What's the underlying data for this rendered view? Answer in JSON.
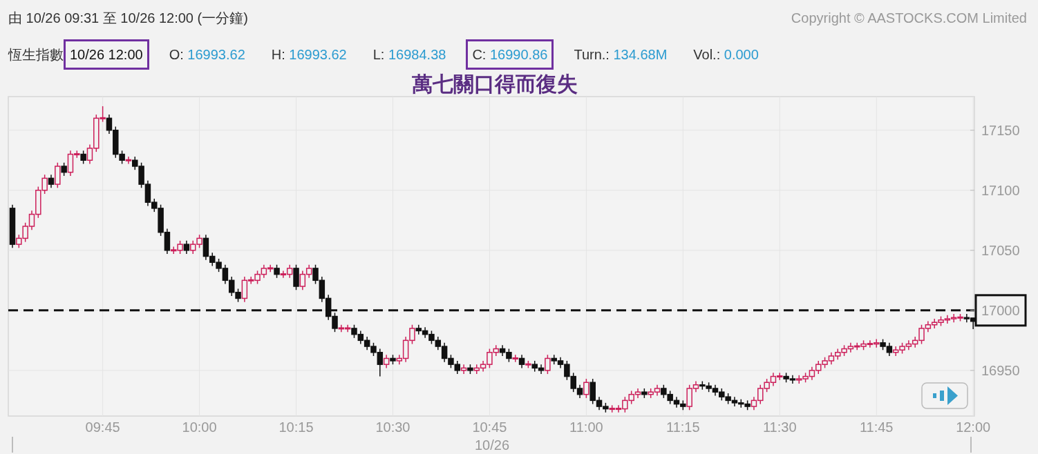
{
  "header": {
    "range": "由 10/26 09:31 至 10/26 12:00 (一分鐘)",
    "copyright": "Copyright © AASTOCKS.COM Limited"
  },
  "quote": {
    "index_name": "恆生指數",
    "time": {
      "text": "10/26 12:00",
      "highlighted": true
    },
    "fields": [
      {
        "label": "O:",
        "value": "16993.62",
        "highlighted": false
      },
      {
        "label": "H:",
        "value": "16993.62",
        "highlighted": false
      },
      {
        "label": "L:",
        "value": "16984.38",
        "highlighted": false
      },
      {
        "label": "C:",
        "value": "16990.86",
        "highlighted": true
      },
      {
        "label": "Turn.:",
        "value": "134.68M",
        "highlighted": false
      },
      {
        "label": "Vol.:",
        "value": "0.000",
        "highlighted": false
      }
    ]
  },
  "headline": "萬七關口得而復失",
  "chart": {
    "date_label": "10/26",
    "chart_data": {
      "type": "candlestick",
      "grid": true,
      "ylim": [
        16912,
        17178
      ],
      "yticks": [
        16950,
        17000,
        17050,
        17100,
        17150
      ],
      "categories": [
        null,
        null,
        null,
        null,
        null,
        null,
        null,
        null,
        null,
        null,
        null,
        null,
        null,
        null,
        "09:45",
        null,
        null,
        null,
        null,
        null,
        null,
        null,
        null,
        null,
        null,
        null,
        null,
        null,
        null,
        "10:00",
        null,
        null,
        null,
        null,
        null,
        null,
        null,
        null,
        null,
        null,
        null,
        null,
        null,
        null,
        "10:15",
        null,
        null,
        null,
        null,
        null,
        null,
        null,
        null,
        null,
        null,
        null,
        null,
        null,
        null,
        "10:30",
        null,
        null,
        null,
        null,
        null,
        null,
        null,
        null,
        null,
        null,
        null,
        null,
        null,
        null,
        "10:45",
        null,
        null,
        null,
        null,
        null,
        null,
        null,
        null,
        null,
        null,
        null,
        null,
        null,
        null,
        "11:00",
        null,
        null,
        null,
        null,
        null,
        null,
        null,
        null,
        null,
        null,
        null,
        null,
        null,
        null,
        "11:15",
        null,
        null,
        null,
        null,
        null,
        null,
        null,
        null,
        null,
        null,
        null,
        null,
        null,
        null,
        "11:30",
        null,
        null,
        null,
        null,
        null,
        null,
        null,
        null,
        null,
        null,
        null,
        null,
        null,
        null,
        "11:45",
        null,
        null,
        null,
        null,
        null,
        null,
        null,
        null,
        null,
        null,
        null,
        null,
        null,
        null,
        "12:00"
      ],
      "ohlc": [
        [
          17085,
          17088,
          17052,
          17055
        ],
        [
          17055,
          17063,
          17052,
          17060
        ],
        [
          17060,
          17073,
          17057,
          17070
        ],
        [
          17070,
          17083,
          17067,
          17080
        ],
        [
          17080,
          17103,
          17077,
          17100
        ],
        [
          17100,
          17113,
          17097,
          17110
        ],
        [
          17110,
          17113,
          17102,
          17105
        ],
        [
          17105,
          17123,
          17102,
          17120
        ],
        [
          17120,
          17123,
          17112,
          17115
        ],
        [
          17115,
          17133,
          17112,
          17130
        ],
        [
          17130,
          17133,
          17127,
          17130
        ],
        [
          17130,
          17133,
          17122,
          17125
        ],
        [
          17125,
          17138,
          17122,
          17135
        ],
        [
          17135,
          17163,
          17132,
          17160
        ],
        [
          17160,
          17170,
          17157,
          17160
        ],
        [
          17160,
          17163,
          17147,
          17150
        ],
        [
          17150,
          17153,
          17127,
          17130
        ],
        [
          17130,
          17133,
          17122,
          17125
        ],
        [
          17125,
          17128,
          17122,
          17125
        ],
        [
          17125,
          17128,
          17117,
          17120
        ],
        [
          17120,
          17123,
          17102,
          17105
        ],
        [
          17105,
          17108,
          17087,
          17090
        ],
        [
          17090,
          17093,
          17082,
          17085
        ],
        [
          17085,
          17088,
          17062,
          17065
        ],
        [
          17065,
          17068,
          17047,
          17050
        ],
        [
          17050,
          17053,
          17047,
          17050
        ],
        [
          17050,
          17058,
          17047,
          17055
        ],
        [
          17055,
          17058,
          17047,
          17050
        ],
        [
          17050,
          17058,
          17047,
          17055
        ],
        [
          17055,
          17063,
          17052,
          17060
        ],
        [
          17060,
          17063,
          17042,
          17045
        ],
        [
          17045,
          17048,
          17037,
          17040
        ],
        [
          17040,
          17043,
          17032,
          17035
        ],
        [
          17035,
          17038,
          17022,
          17025
        ],
        [
          17025,
          17028,
          17012,
          17015
        ],
        [
          17015,
          17018,
          17007,
          17010
        ],
        [
          17010,
          17028,
          17007,
          17025
        ],
        [
          17025,
          17028,
          17022,
          17025
        ],
        [
          17025,
          17033,
          17022,
          17030
        ],
        [
          17030,
          17038,
          17027,
          17035
        ],
        [
          17035,
          17038,
          17032,
          17035
        ],
        [
          17035,
          17038,
          17027,
          17030
        ],
        [
          17030,
          17033,
          17027,
          17030
        ],
        [
          17030,
          17038,
          17027,
          17035
        ],
        [
          17035,
          17038,
          17017,
          17020
        ],
        [
          17020,
          17033,
          17017,
          17030
        ],
        [
          17030,
          17038,
          17027,
          17035
        ],
        [
          17035,
          17038,
          17022,
          17025
        ],
        [
          17025,
          17028,
          17007,
          17010
        ],
        [
          17010,
          17013,
          16992,
          16995
        ],
        [
          16995,
          16998,
          16982,
          16985
        ],
        [
          16985,
          16988,
          16982,
          16985
        ],
        [
          16985,
          16988,
          16982,
          16985
        ],
        [
          16985,
          16988,
          16977,
          16980
        ],
        [
          16980,
          16983,
          16972,
          16975
        ],
        [
          16975,
          16978,
          16967,
          16970
        ],
        [
          16970,
          16973,
          16962,
          16965
        ],
        [
          16965,
          16968,
          16945,
          16955
        ],
        [
          16955,
          16963,
          16952,
          16960
        ],
        [
          16960,
          16963,
          16955,
          16958
        ],
        [
          16958,
          16963,
          16955,
          16960
        ],
        [
          16960,
          16978,
          16957,
          16975
        ],
        [
          16975,
          16988,
          16972,
          16985
        ],
        [
          16985,
          16988,
          16980,
          16983
        ],
        [
          16983,
          16986,
          16977,
          16980
        ],
        [
          16980,
          16983,
          16972,
          16975
        ],
        [
          16975,
          16978,
          16967,
          16970
        ],
        [
          16970,
          16973,
          16957,
          16960
        ],
        [
          16960,
          16963,
          16952,
          16955
        ],
        [
          16955,
          16958,
          16947,
          16950
        ],
        [
          16950,
          16955,
          16947,
          16952
        ],
        [
          16952,
          16955,
          16947,
          16950
        ],
        [
          16950,
          16955,
          16947,
          16952
        ],
        [
          16952,
          16958,
          16949,
          16955
        ],
        [
          16955,
          16968,
          16952,
          16965
        ],
        [
          16965,
          16971,
          16962,
          16968
        ],
        [
          16968,
          16971,
          16962,
          16965
        ],
        [
          16965,
          16968,
          16957,
          16960
        ],
        [
          16960,
          16963,
          16957,
          16960
        ],
        [
          16960,
          16963,
          16952,
          16955
        ],
        [
          16955,
          16958,
          16952,
          16955
        ],
        [
          16955,
          16958,
          16949,
          16952
        ],
        [
          16952,
          16955,
          16947,
          16950
        ],
        [
          16950,
          16963,
          16947,
          16960
        ],
        [
          16960,
          16963,
          16955,
          16958
        ],
        [
          16958,
          16961,
          16952,
          16955
        ],
        [
          16955,
          16958,
          16942,
          16945
        ],
        [
          16945,
          16948,
          16932,
          16935
        ],
        [
          16935,
          16938,
          16927,
          16930
        ],
        [
          16930,
          16943,
          16927,
          16940
        ],
        [
          16940,
          16943,
          16922,
          16925
        ],
        [
          16925,
          16928,
          16917,
          16920
        ],
        [
          16920,
          16923,
          16915,
          16918
        ],
        [
          16918,
          16921,
          16915,
          16918
        ],
        [
          16918,
          16921,
          16915,
          16918
        ],
        [
          16918,
          16928,
          16915,
          16925
        ],
        [
          16925,
          16933,
          16922,
          16930
        ],
        [
          16930,
          16935,
          16927,
          16932
        ],
        [
          16932,
          16935,
          16927,
          16930
        ],
        [
          16930,
          16935,
          16927,
          16932
        ],
        [
          16932,
          16938,
          16929,
          16935
        ],
        [
          16935,
          16938,
          16927,
          16930
        ],
        [
          16930,
          16933,
          16922,
          16925
        ],
        [
          16925,
          16928,
          16919,
          16922
        ],
        [
          16922,
          16925,
          16917,
          16920
        ],
        [
          16920,
          16938,
          16917,
          16935
        ],
        [
          16935,
          16941,
          16932,
          16938
        ],
        [
          16938,
          16941,
          16934,
          16937
        ],
        [
          16937,
          16940,
          16932,
          16935
        ],
        [
          16935,
          16938,
          16929,
          16932
        ],
        [
          16932,
          16935,
          16925,
          16928
        ],
        [
          16928,
          16931,
          16922,
          16925
        ],
        [
          16925,
          16928,
          16920,
          16923
        ],
        [
          16923,
          16926,
          16919,
          16922
        ],
        [
          16922,
          16925,
          16917,
          16920
        ],
        [
          16920,
          16928,
          16917,
          16925
        ],
        [
          16925,
          16938,
          16922,
          16935
        ],
        [
          16935,
          16943,
          16932,
          16940
        ],
        [
          16940,
          16948,
          16937,
          16945
        ],
        [
          16945,
          16948,
          16942,
          16945
        ],
        [
          16945,
          16948,
          16940,
          16943
        ],
        [
          16943,
          16946,
          16939,
          16942
        ],
        [
          16942,
          16946,
          16939,
          16943
        ],
        [
          16943,
          16948,
          16940,
          16945
        ],
        [
          16945,
          16953,
          16942,
          16950
        ],
        [
          16950,
          16958,
          16947,
          16955
        ],
        [
          16955,
          16961,
          16952,
          16958
        ],
        [
          16958,
          16965,
          16955,
          16962
        ],
        [
          16962,
          16968,
          16959,
          16965
        ],
        [
          16965,
          16971,
          16962,
          16968
        ],
        [
          16968,
          16973,
          16965,
          16970
        ],
        [
          16970,
          16973,
          16967,
          16970
        ],
        [
          16970,
          16975,
          16967,
          16972
        ],
        [
          16972,
          16975,
          16969,
          16972
        ],
        [
          16972,
          16976,
          16969,
          16973
        ],
        [
          16973,
          16976,
          16967,
          16970
        ],
        [
          16970,
          16973,
          16962,
          16965
        ],
        [
          16965,
          16970,
          16962,
          16967
        ],
        [
          16967,
          16973,
          16964,
          16970
        ],
        [
          16970,
          16975,
          16967,
          16972
        ],
        [
          16972,
          16978,
          16969,
          16975
        ],
        [
          16975,
          16988,
          16972,
          16985
        ],
        [
          16985,
          16991,
          16982,
          16988
        ],
        [
          16988,
          16993,
          16985,
          16990
        ],
        [
          16990,
          16995,
          16987,
          16992
        ],
        [
          16992,
          16996,
          16989,
          16993
        ],
        [
          16993,
          16997,
          16990,
          16994
        ],
        [
          16994,
          16997,
          16991,
          16994
        ],
        [
          16994,
          16997,
          16990,
          16993
        ],
        [
          16993.62,
          16993.62,
          16984.38,
          16990.86
        ]
      ],
      "ref_lines": [
        {
          "axis": "y",
          "value": 17000
        }
      ]
    }
  }
}
